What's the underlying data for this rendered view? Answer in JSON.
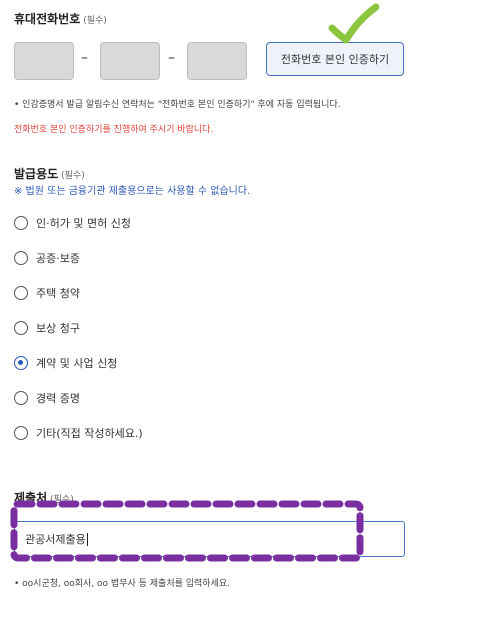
{
  "phone": {
    "label": "휴대전화번호",
    "required": "(필수)",
    "separator": "–",
    "verify_button": "전화번호 본인 인증하기",
    "note": "• 인감증명서 발급 알림수신 연락처는 \"전화번호 본인 인증하기\" 후에 자동 입력됩니다.",
    "warning": "전화번호 본인 인증하기를 진행하여 주시기 바랍니다."
  },
  "purpose": {
    "label": "발급용도",
    "required": "(필수)",
    "sub_note": "※ 법원 또는 금융기관 제출용으로는 사용할 수 없습니다.",
    "options": [
      {
        "label": "인·허가 및 면허 신청",
        "checked": false
      },
      {
        "label": "공증·보증",
        "checked": false
      },
      {
        "label": "주택 청약",
        "checked": false
      },
      {
        "label": "보상 청구",
        "checked": false
      },
      {
        "label": "계약 및 사업 신청",
        "checked": true
      },
      {
        "label": "경력 증명",
        "checked": false
      },
      {
        "label": "기타(직접 작성하세요.)",
        "checked": false
      }
    ]
  },
  "submit_to": {
    "label": "제출처",
    "required": "(필수)",
    "value": "관공서제출용",
    "note": "• oo시군청, oo회사, oo 법무사 등 제출처를 입력하세요."
  },
  "colors": {
    "accent": "#2c5ab8",
    "warning": "#e0433b",
    "check_mark": "#8cc63f",
    "annotation": "#7a2fa0"
  }
}
